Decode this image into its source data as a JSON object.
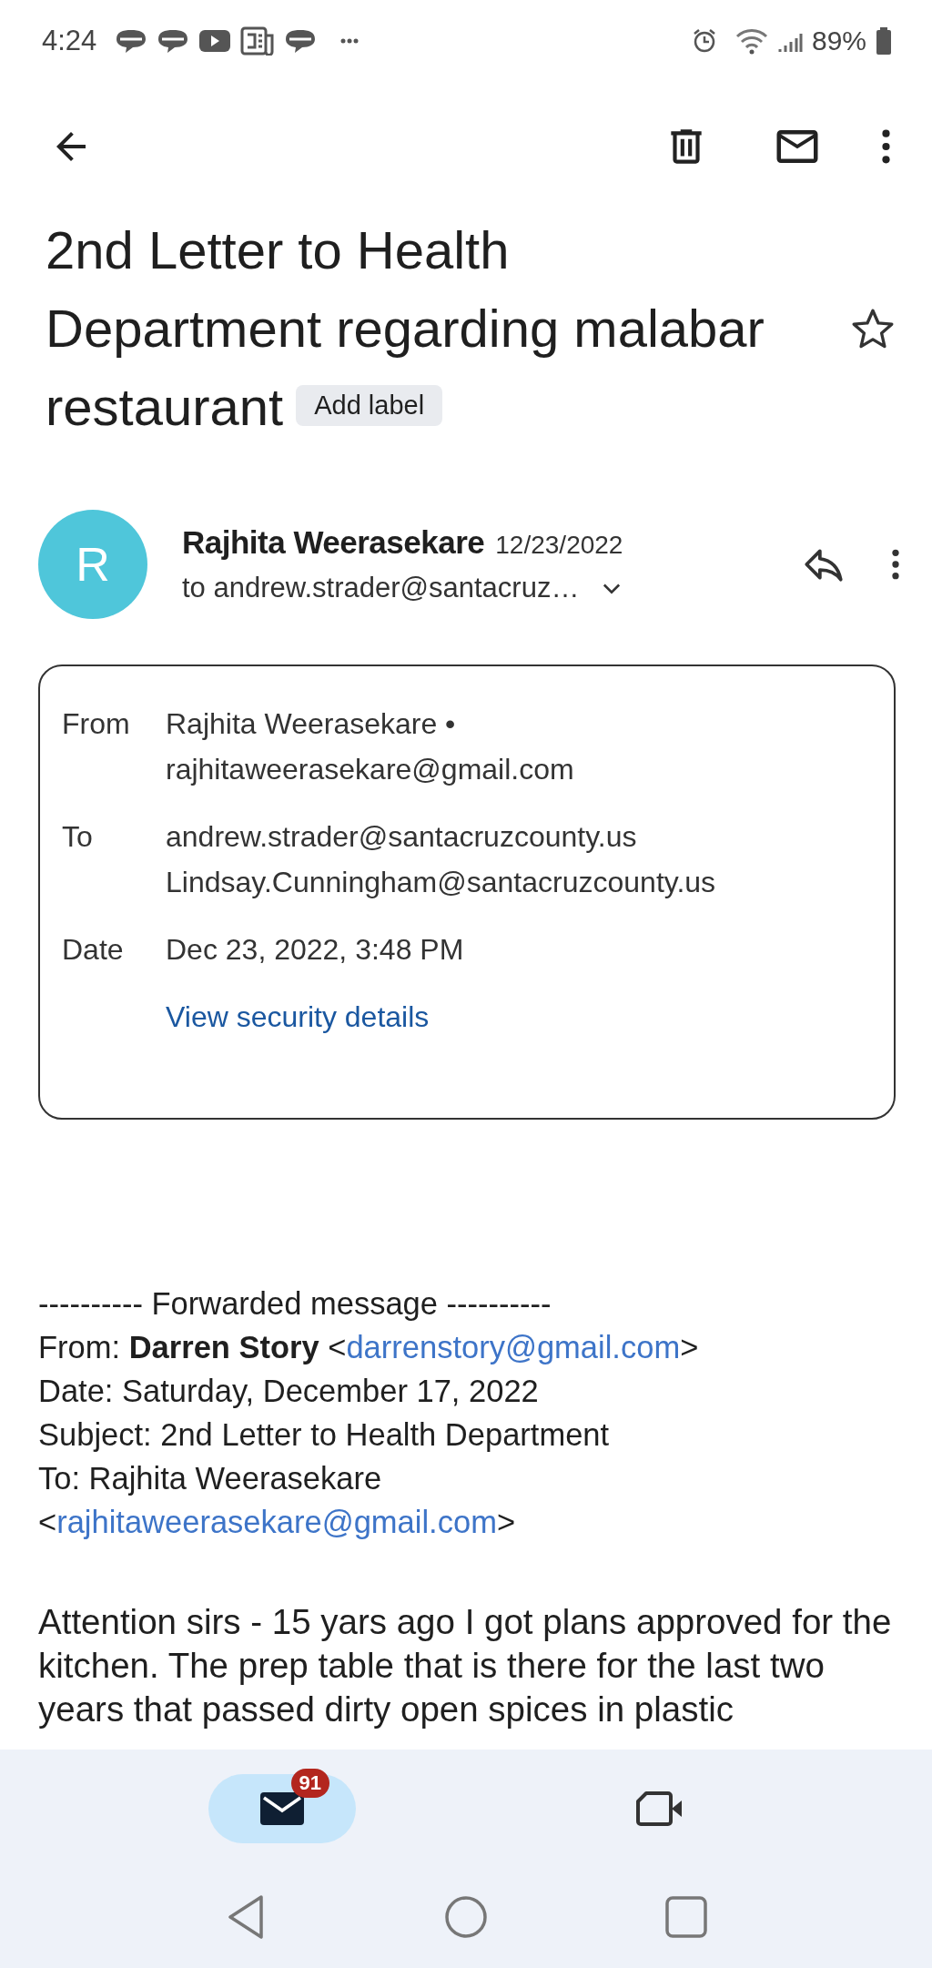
{
  "status_bar": {
    "time": "4:24",
    "battery": "89%"
  },
  "subject": {
    "title": "2nd Letter to Health Department regarding malabar restaurant",
    "label_button": "Add label",
    "starred": false
  },
  "sender": {
    "initial": "R",
    "name": "Rajhita Weerasekare",
    "date": "12/23/2022",
    "recipients": "to andrew.strader@santacruz…"
  },
  "details": {
    "rows": [
      {
        "label": "From",
        "values": [
          "Rajhita Weerasekare •",
          "rajhitaweerasekare@gmail.com"
        ]
      },
      {
        "label": "To",
        "values": [
          "andrew.strader@santacruzcounty.us",
          "Lindsay.Cunningham@santacruzcounty.us"
        ]
      },
      {
        "label": "Date",
        "values": [
          "Dec 23, 2022, 3:48 PM"
        ]
      }
    ],
    "link": "View security details"
  },
  "forwarded": [
    [
      {
        "kind": "text",
        "text": "---------- Forwarded message ----------"
      }
    ],
    [
      {
        "kind": "text",
        "text": "From: "
      },
      {
        "kind": "bold",
        "text": "Darren Story"
      },
      {
        "kind": "text",
        "text": " <"
      },
      {
        "kind": "link",
        "text": "darrenstory@gmail.com"
      },
      {
        "kind": "text",
        "text": ">"
      }
    ],
    [
      {
        "kind": "text",
        "text": "Date: Saturday, December 17, 2022"
      }
    ],
    [
      {
        "kind": "text",
        "text": "Subject: 2nd Letter to Health Department"
      }
    ],
    [
      {
        "kind": "text",
        "text": "To: Rajhita Weerasekare"
      }
    ],
    [
      {
        "kind": "text",
        "text": "<"
      },
      {
        "kind": "link",
        "text": "rajhitaweerasekare@gmail.com"
      },
      {
        "kind": "text",
        "text": ">"
      }
    ]
  ],
  "body": "Attention sirs - 15 yars ago I got plans approved for the kitchen. The prep table that is there for the last two years that passed dirty open spices in plastic",
  "bottom_nav": [
    {
      "kind": "mail",
      "selected": true,
      "badge": "91"
    },
    {
      "kind": "meet",
      "selected": false
    }
  ]
}
